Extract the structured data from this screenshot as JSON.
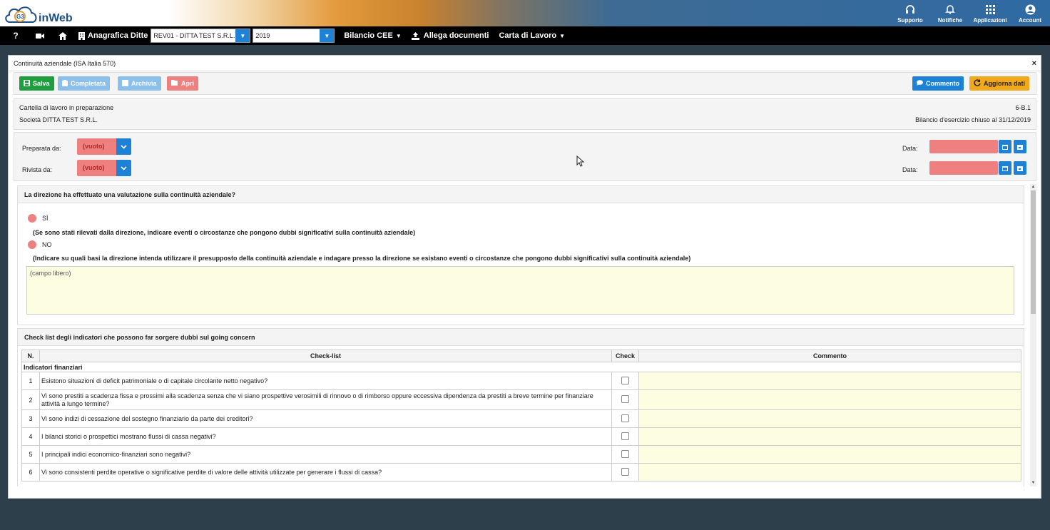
{
  "brand": {
    "logo_text": "inWeb",
    "logo_mark": "G3"
  },
  "top_actions": [
    {
      "label": "Supporto",
      "icon": "headset-icon"
    },
    {
      "label": "Notifiche",
      "icon": "bell-icon"
    },
    {
      "label": "Applicazioni",
      "icon": "grid-icon"
    },
    {
      "label": "Account",
      "icon": "user-circle-icon"
    }
  ],
  "nav": {
    "help_icon": "?",
    "anagrafica_label": "Anagrafica Ditte",
    "company_value": "REV01 - DITTA TEST S.R.L.",
    "year_value": "2019",
    "bilancio_label": "Bilancio CEE",
    "allega_label": "Allega documenti",
    "carta_label": "Carta di Lavoro"
  },
  "modal": {
    "title": "Continuità aziendale (ISA Italia 570)",
    "close": "×"
  },
  "toolbar": {
    "save_label": "Salva",
    "completed_label": "Completata",
    "archive_label": "Archivia",
    "open_label": "Apri",
    "comment_label": "Commento",
    "update_label": "Aggiorna dati"
  },
  "info": {
    "status": "Cartella di lavoro in preparazione",
    "company": "Società DITTA TEST S.R.L.",
    "code": "6-B.1",
    "period": "Bilancio d'esercizio chiuso al 31/12/2019"
  },
  "prep": {
    "prepared_label": "Preparata da:",
    "prepared_value": "(vuoto)",
    "reviewed_label": "Rivista da:",
    "reviewed_value": "(vuoto)",
    "date_label": "Data:"
  },
  "question": {
    "title": "La direzione ha effettuato una valutazione sulla continuità aziendale?",
    "yes_label": "SÌ",
    "yes_note": "(Se sono stati rilevati dalla direzione, indicare eventi o circostanze che pongono dubbi significativi sulla continuità aziendale)",
    "no_label": "NO",
    "no_note": "(Indicare su quali basi la direzione intenda utilizzare il presupposto della continuità aziendale e indagare presso la direzione se esistano eventi o circostanze che pongono dubbi significativi sulla continuità aziendale)",
    "free_text": "(campo libero)"
  },
  "checklist": {
    "title": "Check list degli indicatori che possono far sorgere dubbi sul going concern",
    "columns": [
      "N.",
      "Check-list",
      "Check",
      "Commento"
    ],
    "group": "Indicatori finanziari",
    "rows": [
      {
        "n": "1",
        "text": "Esistono situazioni di deficit patrimoniale o di capitale circolante netto negativo?"
      },
      {
        "n": "2",
        "text": "Vi sono prestiti a scadenza fissa e prossimi alla scadenza senza che vi siano prospettive verosimili di rinnovo o di rimborso oppure eccessiva dipendenza da prestiti a breve termine per finanziare attività a lungo termine?"
      },
      {
        "n": "3",
        "text": "Vi sono indizi di cessazione del sostegno finanziario da parte dei creditori?"
      },
      {
        "n": "4",
        "text": "I bilanci storici o prospettici mostrano flussi di cassa negativi?"
      },
      {
        "n": "5",
        "text": "I principali indici economico-finanziari sono negativi?"
      },
      {
        "n": "6",
        "text": "Vi sono consistenti perdite operative o significative perdite di valore delle attività utilizzate per generare i flussi di cassa?"
      }
    ]
  },
  "colors": {
    "primary": "#1d82d6",
    "success": "#1e9e3e",
    "warning": "#f0a81c",
    "danger_fill": "#ee8080",
    "note_fill": "#fdfde1"
  }
}
